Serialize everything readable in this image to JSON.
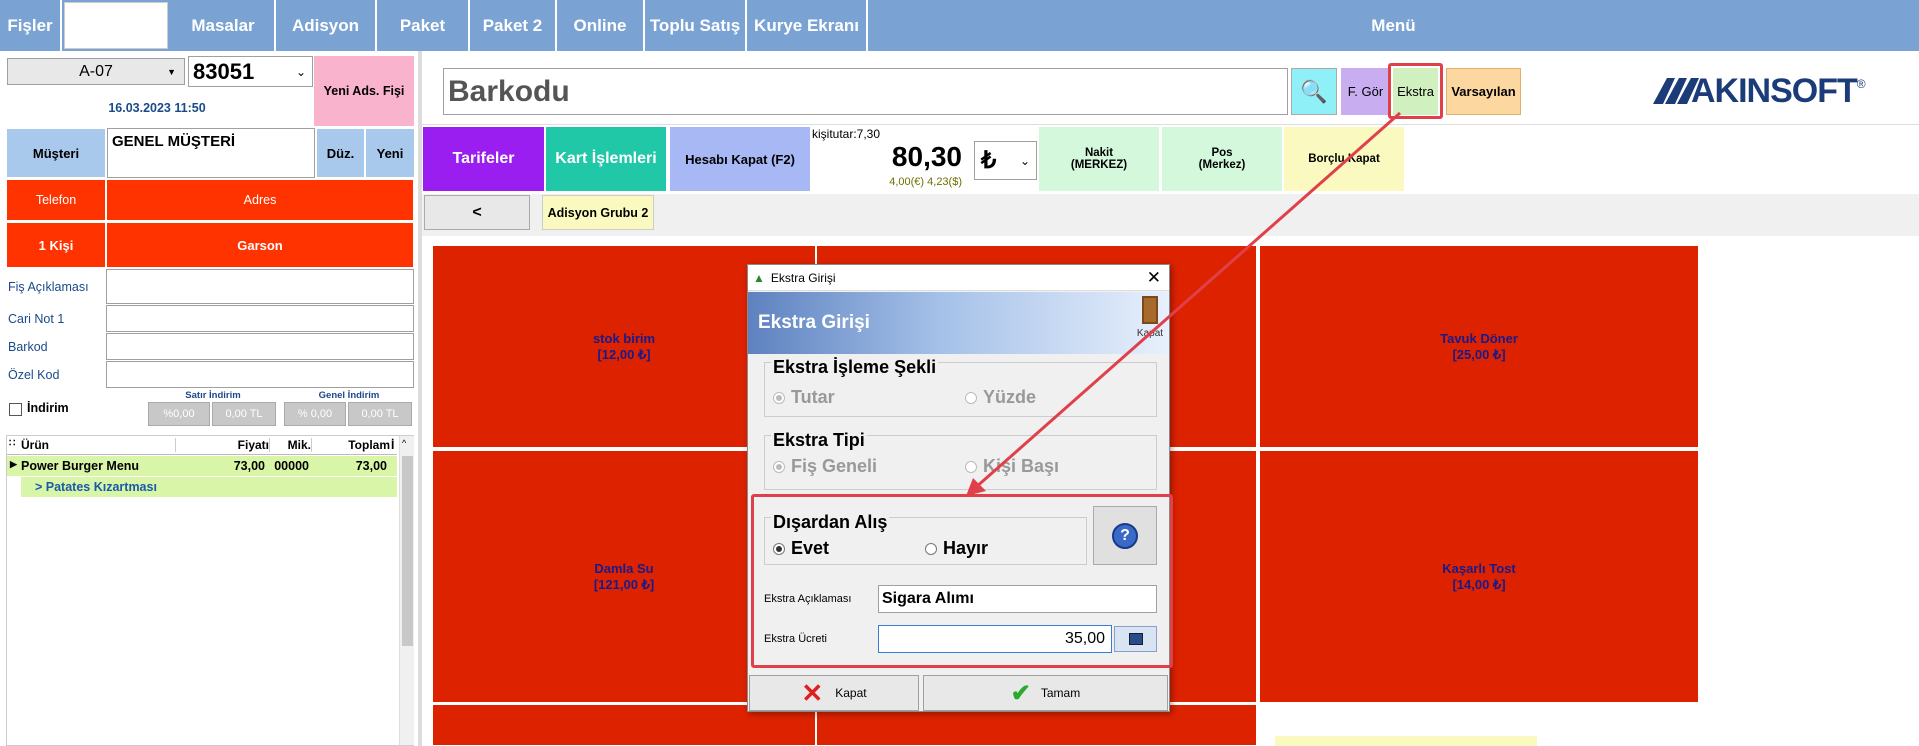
{
  "nav": {
    "fisler": "Fişler",
    "masalar": "Masalar",
    "adisyon": "Adisyon",
    "paket": "Paket",
    "paket2": "Paket 2",
    "online": "Online",
    "toplu_satis": "Toplu Satış",
    "kurye": "Kurye Ekranı",
    "menu": "Menü"
  },
  "left": {
    "table_select": "A-07",
    "fis_no": "83051",
    "yeni_ads_fisi": "Yeni Ads. Fişi",
    "date": "16.03.2023 11:50",
    "musteri_label": "Müşteri",
    "musteri_value": "GENEL MÜŞTERİ",
    "duz": "Düz.",
    "yeni": "Yeni",
    "telefon": "Telefon",
    "adres": "Adres",
    "kisi": "1 Kişi",
    "garson": "Garson",
    "fis_aciklamasi": "Fiş Açıklaması",
    "cari_not": "Cari Not 1",
    "barkod": "Barkod",
    "ozel_kod": "Özel Kod",
    "indirim": "İndirim",
    "satir_indirim": "Satır İndirim",
    "genel_indirim": "Genel İndirim",
    "satir_pct": "%0,00",
    "satir_tl": "0,00 TL",
    "genel_pct": "% 0,00",
    "genel_tl": "0,00 TL",
    "grid_headers": [
      "Ürün",
      "Fiyatı",
      "Mik.",
      "Toplam",
      "İ"
    ],
    "grid_rows": [
      {
        "urun": "Power Burger Menu",
        "fiyat": "73,00",
        "mik": "00000",
        "toplam": "73,00"
      },
      {
        "urun": "> Patates Kızartması",
        "fiyat": "",
        "mik": "",
        "toplam": ""
      }
    ]
  },
  "toolbar": {
    "barkod_placeholder": "Barkodu",
    "f_gor": "F. Gör",
    "ekstra": "Ekstra",
    "varsayilan": "Varsayılan",
    "logo": "AKINSOFT",
    "logo_reg": "®"
  },
  "actions": {
    "tarifeler": "Tarifeler",
    "kart_islemleri": "Kart İşlemleri",
    "hesabi_kapat": "Hesabı Kapat (F2)",
    "kisi_tutar": "kişitutar:7,30",
    "total": "80,30",
    "fx": "4,00(€) 4,23($)",
    "currency": "₺",
    "nakit": "Nakit\n(MERKEZ)",
    "pos": "Pos\n(Merkez)",
    "borclu_kapat": "Borçlu Kapat",
    "back": "<",
    "adisyon_grubu": "Adisyon Grubu 2"
  },
  "tiles": [
    {
      "name": "stok birim",
      "price": "[12,00 ₺]"
    },
    {
      "name": "Tavuk Döner",
      "price": "[25,00 ₺]"
    },
    {
      "name": "Damla Su",
      "price": "[121,00 ₺]"
    },
    {
      "name": "Kaşarlı Tost",
      "price": "[14,00 ₺]"
    }
  ],
  "dialog": {
    "window_title": "Ekstra Girişi",
    "header": "Ekstra Girişi",
    "kapat_icon_label": "Kapat",
    "isleme_sekli": "Ekstra İşleme Şekli",
    "tutar": "Tutar",
    "yuzde": "Yüzde",
    "ekstra_tipi": "Ekstra Tipi",
    "fis_geneli": "Fiş Geneli",
    "kisi_basi": "Kişi Başı",
    "disardan_alis": "Dışardan Alış",
    "evet": "Evet",
    "hayir": "Hayır",
    "aciklama_label": "Ekstra Açıklaması",
    "aciklama_value": "Sigara Alımı",
    "ucret_label": "Ekstra Ücreti",
    "ucret_value": "35,00",
    "kapat_btn": "Kapat",
    "tamam_btn": "Tamam"
  },
  "colors": {
    "nav": "#7aa3d4",
    "tile_red": "#dd2200",
    "highlight": "#e0404a"
  }
}
